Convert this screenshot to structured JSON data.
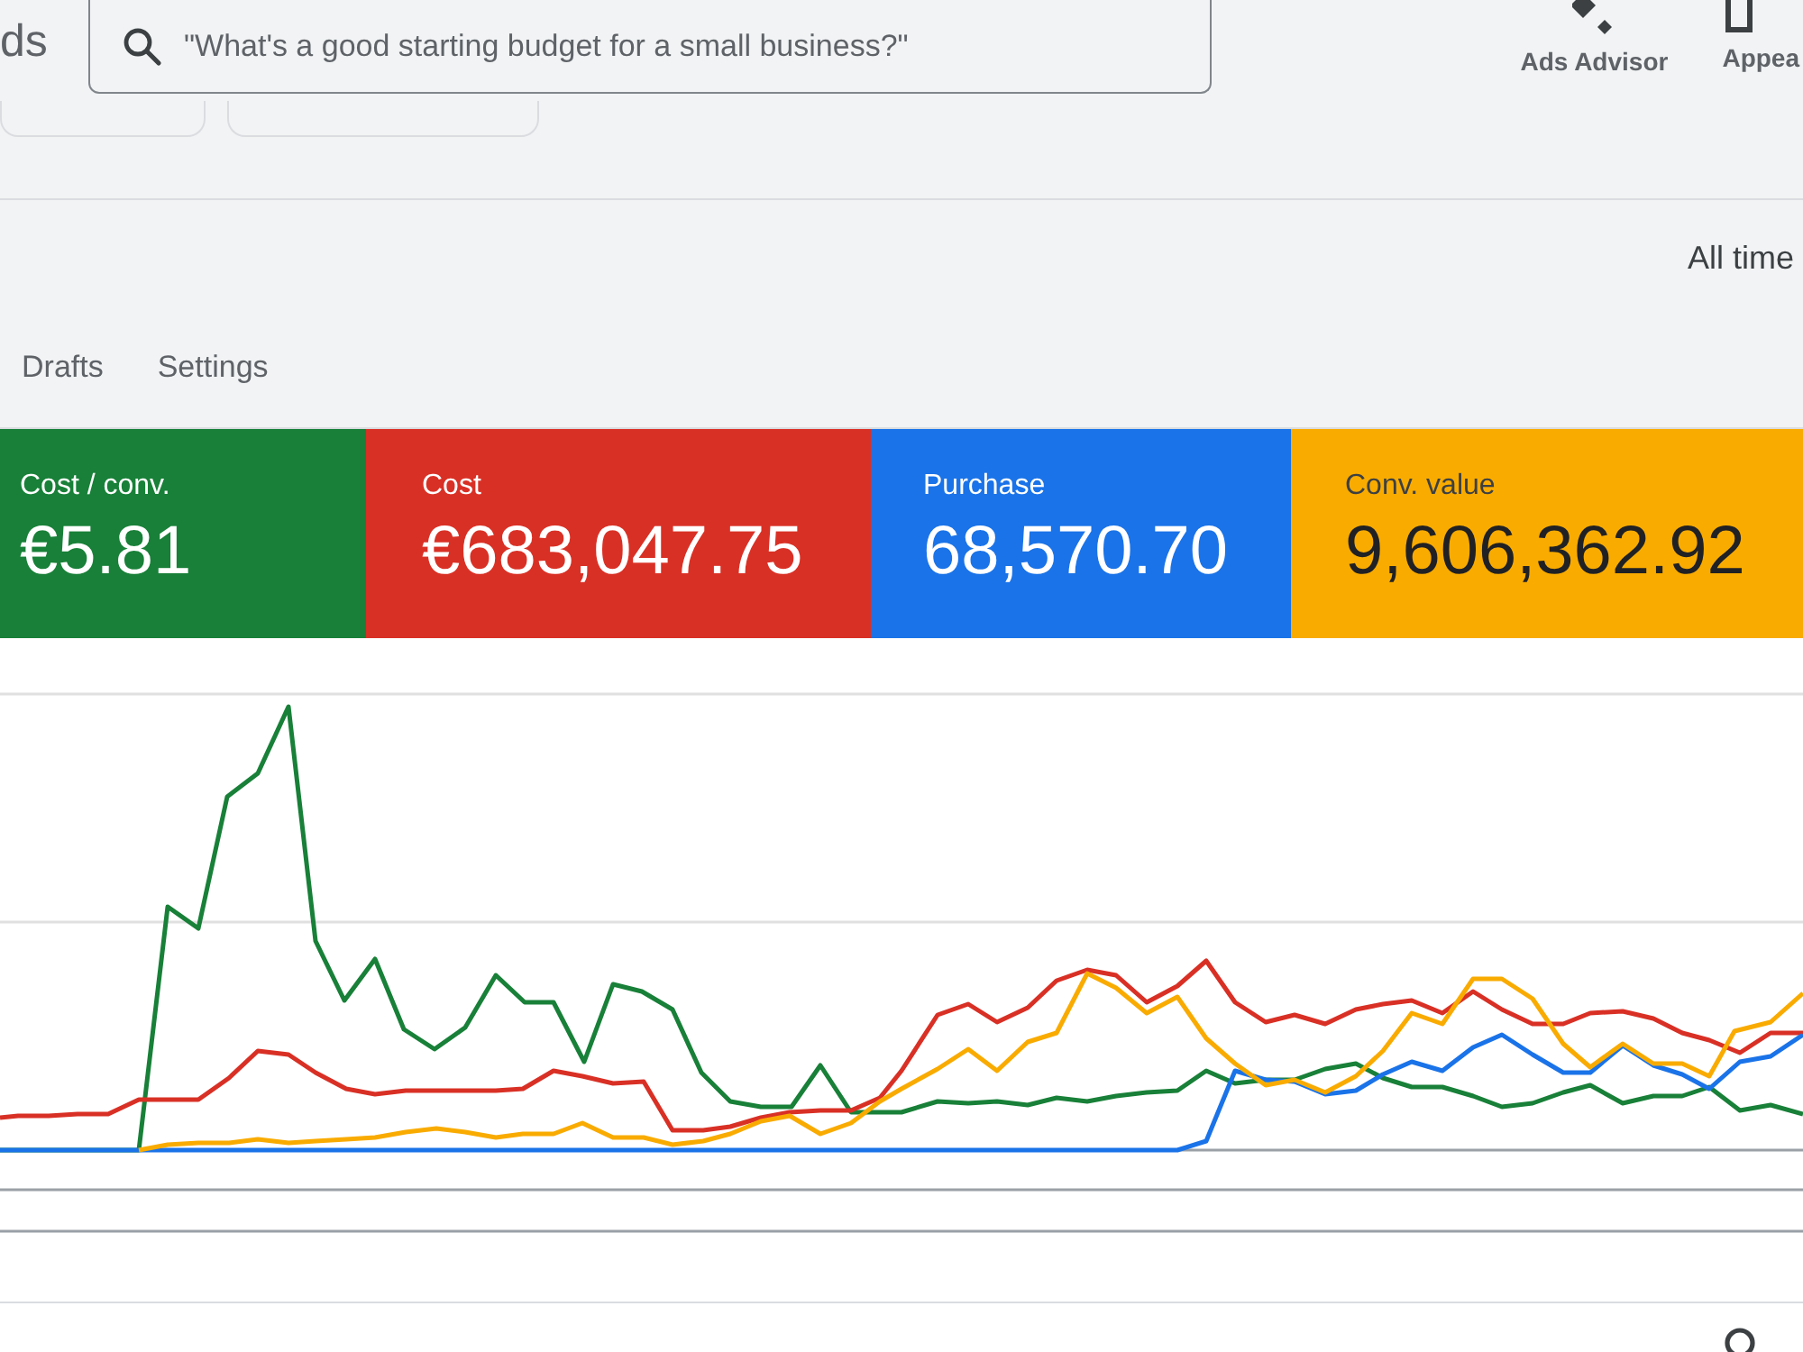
{
  "header": {
    "logo_text": "ds",
    "search": {
      "value": "\"What's a good starting budget for a small business?\""
    },
    "tools": [
      {
        "label": "Ads Advisor",
        "kind": "advisor"
      },
      {
        "label": "Appea",
        "kind": "appearance"
      }
    ]
  },
  "date_range": {
    "label": "All time"
  },
  "tabs": [
    {
      "label": "Drafts",
      "selected": false
    },
    {
      "label": "Settings",
      "selected": false
    }
  ],
  "metrics": [
    {
      "label": "Cost / conv.",
      "value": "€5.81",
      "color": "#188038"
    },
    {
      "label": "Cost",
      "value": "€683,047.75",
      "color": "#d93025"
    },
    {
      "label": "Purchase",
      "value": "68,570.70",
      "color": "#1a73e8"
    },
    {
      "label": "Conv. value",
      "value": "9,606,362.92",
      "color": "#f9ab00"
    }
  ]
}
